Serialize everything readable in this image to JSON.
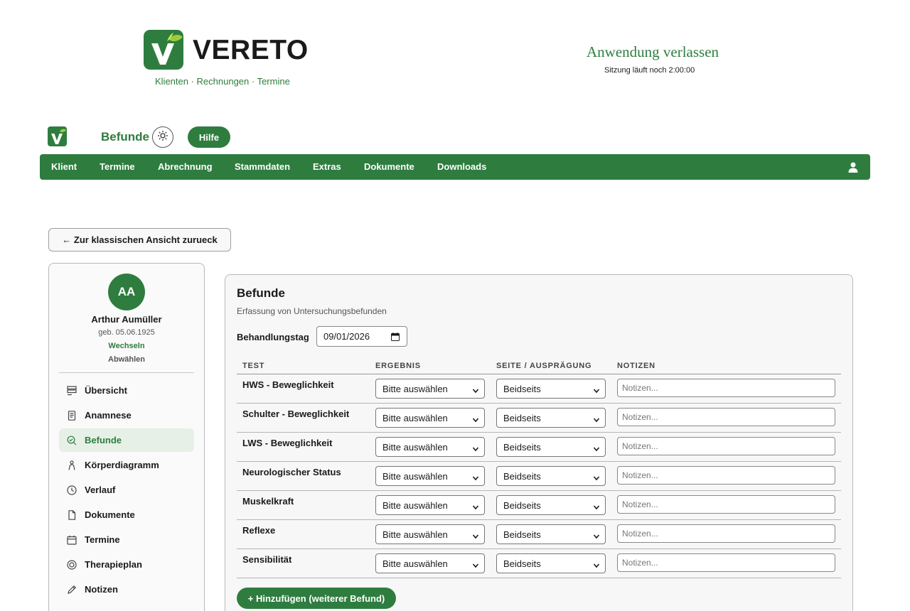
{
  "header": {
    "brand_name": "VERETO",
    "tagline": "Klienten · Rechnungen · Termine",
    "leave_app": "Anwendung verlassen",
    "session_text": "Sitzung läuft noch 2:00:00",
    "brand_color": "#2e7d3f"
  },
  "toolbar": {
    "section_title": "Befunde",
    "theme_icon": "sun-icon",
    "help_label": "Hilfe"
  },
  "nav": {
    "items": [
      "Klient",
      "Termine",
      "Abrechnung",
      "Stammdaten",
      "Extras",
      "Dokumente",
      "Downloads"
    ],
    "user_icon": "user-icon"
  },
  "back_button": "← Zur klassischen Ansicht zurueck",
  "client": {
    "initials": "AA",
    "name": "Arthur Aumüller",
    "dob": "geb. 05.06.1925",
    "switch_label": "Wechseln",
    "deselect_label": "Abwählen"
  },
  "sidebar": {
    "items": [
      {
        "label": "Übersicht",
        "icon": "overview-icon"
      },
      {
        "label": "Anamnese",
        "icon": "document-list-icon"
      },
      {
        "label": "Befunde",
        "icon": "search-check-icon",
        "active": true
      },
      {
        "label": "Körperdiagramm",
        "icon": "person-icon"
      },
      {
        "label": "Verlauf",
        "icon": "clock-icon"
      },
      {
        "label": "Dokumente",
        "icon": "file-icon"
      },
      {
        "label": "Termine",
        "icon": "calendar-icon"
      },
      {
        "label": "Therapieplan",
        "icon": "target-icon"
      },
      {
        "label": "Notizen",
        "icon": "pencil-icon"
      }
    ]
  },
  "panel": {
    "title": "Befunde",
    "subtitle": "Erfassung von Untersuchungsbefunden",
    "day_label": "Behandlungstag",
    "day_value": "09/01/2026",
    "columns": [
      "TEST",
      "ERGEBNIS",
      "SEITE / AUSPRÄGUNG",
      "NOTIZEN"
    ],
    "rows": [
      {
        "test": "HWS - Beweglichkeit",
        "result": "Bitte auswählen",
        "side": "Beidseits",
        "notes_placeholder": "Notizen..."
      },
      {
        "test": "Schulter - Beweglichkeit",
        "result": "Bitte auswählen",
        "side": "Beidseits",
        "notes_placeholder": "Notizen..."
      },
      {
        "test": "LWS - Beweglichkeit",
        "result": "Bitte auswählen",
        "side": "Beidseits",
        "notes_placeholder": "Notizen..."
      },
      {
        "test": "Neurologischer Status",
        "result": "Bitte auswählen",
        "side": "Beidseits",
        "notes_placeholder": "Notizen..."
      },
      {
        "test": "Muskelkraft",
        "result": "Bitte auswählen",
        "side": "Beidseits",
        "notes_placeholder": "Notizen..."
      },
      {
        "test": "Reflexe",
        "result": "Bitte auswählen",
        "side": "Beidseits",
        "notes_placeholder": "Notizen..."
      },
      {
        "test": "Sensibilität",
        "result": "Bitte auswählen",
        "side": "Beidseits",
        "notes_placeholder": "Notizen..."
      }
    ],
    "add_button": "+ Hinzufügen (weiterer Befund)"
  }
}
